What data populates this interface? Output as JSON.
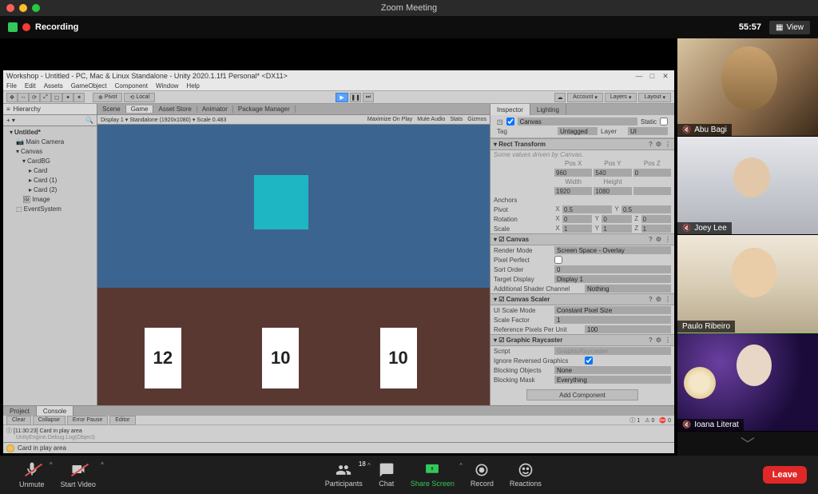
{
  "titlebar": {
    "title": "Zoom Meeting"
  },
  "recording": {
    "label": "Recording",
    "elapsed": "55:57",
    "view_label": "View"
  },
  "unity": {
    "window_title": "Workshop - Untitled - PC, Mac & Linux Standalone - Unity 2020.1.1f1 Personal* <DX11>",
    "menu": [
      "File",
      "Edit",
      "Assets",
      "GameObject",
      "Component",
      "Window",
      "Help"
    ],
    "toolbar": {
      "pivot": "Pivot",
      "local": "Local",
      "account": "Account",
      "layers": "Layers",
      "layout": "Layout"
    },
    "hierarchy": {
      "tab": "Hierarchy",
      "items": [
        {
          "label": "Untitled*",
          "depth": 0
        },
        {
          "label": "Main Camera",
          "depth": 1
        },
        {
          "label": "Canvas",
          "depth": 1
        },
        {
          "label": "CardBG",
          "depth": 2
        },
        {
          "label": "Card",
          "depth": 3
        },
        {
          "label": "Card (1)",
          "depth": 3
        },
        {
          "label": "Card (2)",
          "depth": 3
        },
        {
          "label": "Image",
          "depth": 2
        },
        {
          "label": "EventSystem",
          "depth": 1
        }
      ]
    },
    "center": {
      "tabs": [
        "Scene",
        "Game",
        "Asset Store",
        "Animator",
        "Package Manager"
      ],
      "bar_left": {
        "display": "Display 1",
        "aspect": "Standalone (1920x1080)",
        "scale_label": "Scale",
        "scale_value": "0.483"
      },
      "bar_right": [
        "Maximize On Play",
        "Mute Audio",
        "Stats",
        "Gizmos"
      ],
      "cards": [
        "12",
        "10",
        "10"
      ]
    },
    "inspector": {
      "tabs": [
        "Inspector",
        "Lighting"
      ],
      "object_name": "Canvas",
      "static_label": "Static",
      "tag_label": "Tag",
      "tag_value": "Untagged",
      "layer_label": "Layer",
      "layer_value": "UI",
      "rect": {
        "header": "Rect Transform",
        "note": "Some values driven by Canvas.",
        "posx_l": "Pos X",
        "posx": "960",
        "posy_l": "Pos Y",
        "posy": "540",
        "posz_l": "Pos Z",
        "posz": "0",
        "width_l": "Width",
        "width": "1920",
        "height_l": "Height",
        "height": "1080",
        "anchors": "Anchors",
        "pivot": "Pivot",
        "pivot_x": "0.5",
        "pivot_y": "0.5",
        "rotation": "Rotation",
        "rot_x": "0",
        "rot_y": "0",
        "rot_z": "0",
        "scale": "Scale",
        "sc_x": "1",
        "sc_y": "1",
        "sc_z": "1"
      },
      "canvas": {
        "header": "Canvas",
        "render_mode_l": "Render Mode",
        "render_mode": "Screen Space - Overlay",
        "pixel_perfect": "Pixel Perfect",
        "sort_order_l": "Sort Order",
        "sort_order": "0",
        "target_display_l": "Target Display",
        "target_display": "Display 1",
        "shader_l": "Additional Shader Channel",
        "shader": "Nothing"
      },
      "scaler": {
        "header": "Canvas Scaler",
        "mode_l": "UI Scale Mode",
        "mode": "Constant Pixel Size",
        "factor_l": "Scale Factor",
        "factor": "1",
        "refpx_l": "Reference Pixels Per Unit",
        "refpx": "100"
      },
      "raycaster": {
        "header": "Graphic Raycaster",
        "script_l": "Script",
        "script": "GraphicRaycaster",
        "ignore_l": "Ignore Reversed Graphics",
        "blocking_obj_l": "Blocking Objects",
        "blocking_obj": "None",
        "blocking_mask_l": "Blocking Mask",
        "blocking_mask": "Everything"
      },
      "add_component": "Add Component"
    },
    "console": {
      "tabs": [
        "Project",
        "Console"
      ],
      "buttons": [
        "Clear",
        "Collapse",
        "Error Pause",
        "Editor"
      ],
      "count1": "1",
      "count2": "0",
      "count3": "0",
      "log_line1": "[11:30:23] Card in play area",
      "log_line2": "UnityEngine.Debug.Log(Object)"
    },
    "status": {
      "msg": "Card in play area"
    }
  },
  "participants": [
    {
      "name": "Abu Bagi",
      "muted": true
    },
    {
      "name": "Joey Lee",
      "muted": true
    },
    {
      "name": "Paulo Ribeiro",
      "muted": false,
      "highlight": true
    },
    {
      "name": "Ioana Literat",
      "muted": true
    }
  ],
  "zoombar": {
    "unmute": "Unmute",
    "startvideo": "Start Video",
    "participants": "Participants",
    "participants_count": "18",
    "chat": "Chat",
    "share": "Share Screen",
    "record": "Record",
    "reactions": "Reactions",
    "leave": "Leave"
  }
}
